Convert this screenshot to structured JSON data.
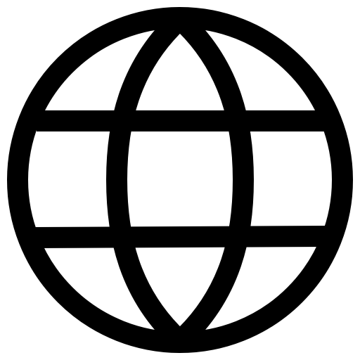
{
  "icon": {
    "name": "globe-icon",
    "color": "#000000",
    "background": "#ffffff"
  }
}
